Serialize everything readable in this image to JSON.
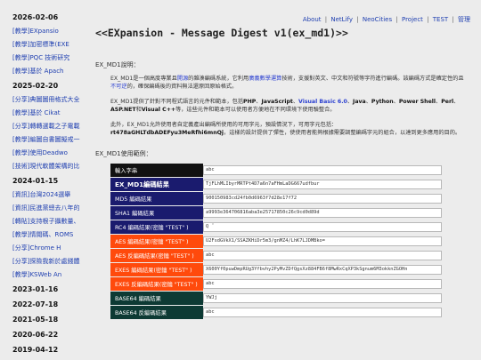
{
  "sidebar": {
    "entries": [
      {
        "type": "date",
        "text": "2026-02-06"
      },
      {
        "type": "link",
        "text": "[教學]EXpansio"
      },
      {
        "type": "link",
        "text": "[教學]加密標準(EXE"
      },
      {
        "type": "link",
        "text": "[教學]PQC 技術研究"
      },
      {
        "type": "link",
        "text": "[教學]基於 Apach"
      },
      {
        "type": "date",
        "text": "2025-02-20"
      },
      {
        "type": "link",
        "text": "[分享]典圖圖冊格式大全"
      },
      {
        "type": "link",
        "text": "[教學]基於 Cikat"
      },
      {
        "type": "link",
        "text": "[分享]轉轉選載之子電載"
      },
      {
        "type": "link",
        "text": "[教學]編圖自書圖擬戒一"
      },
      {
        "type": "link",
        "text": "[教學]使用Deadwo"
      },
      {
        "type": "link",
        "text": "[技術]現代軟體架構的比"
      },
      {
        "type": "date",
        "text": "2024-01-15"
      },
      {
        "type": "link",
        "text": "[資訊]台灣2024選舉"
      },
      {
        "type": "link",
        "text": "[資訊]民進黨總去八年的"
      },
      {
        "type": "link",
        "text": "[轉貼]支持根子攝數量、"
      },
      {
        "type": "link",
        "text": "[教學]情閱碼、ROMS"
      },
      {
        "type": "link",
        "text": "[分享]Chrome H"
      },
      {
        "type": "link",
        "text": "[分享]探險我新於處錢體"
      },
      {
        "type": "link",
        "text": "[教學]KSWeb An"
      },
      {
        "type": "date",
        "text": "2023-01-16"
      },
      {
        "type": "date",
        "text": "2022-07-18"
      },
      {
        "type": "date",
        "text": "2021-05-18"
      },
      {
        "type": "date",
        "text": "2020-06-22"
      },
      {
        "type": "date",
        "text": "2019-04-12"
      },
      {
        "type": "date",
        "text": "2018-07-18"
      }
    ]
  },
  "nav": {
    "about": "About",
    "netlify": "NetLify",
    "neocities": "NeoCities",
    "project": "Project",
    "test": "TEST",
    "admin": "管理",
    "sep": "|"
  },
  "page": {
    "title": "<<EXpansion - Message Digest v1(ex_md1)>>",
    "intro_label": "EX_MD1說明：",
    "p1_a": "EX_MD1是一個高度專業且",
    "p1_link1": "開源",
    "p1_b": "的雜湊編碼系統，它利用",
    "p1_link2": "廣義數學運算",
    "p1_c": "技術，支援對英文、中文和符號等字符進行編碼。該編碼方式是確定性的且",
    "p1_link3": "不可逆",
    "p1_d": "的，確保編碼後的資料無法還原回原始格式。",
    "p2_a": "EX_MD1提供了針對不同程式語言的元件和範本，包括",
    "p2_php": "PHP",
    "p2_js": "JavaScript",
    "p2_vb": "Visual Basic 6.0",
    "p2_java": "Java",
    "p2_py": "Python",
    "p2_ps": "Power Shell",
    "p2_perl": "Perl",
    "p2_asp": "ASP.NET",
    "p2_cpp": "Visual C++",
    "p2_and": "和",
    "p2_dot": "、",
    "p2_b": "等，這些元件和範本可以使用者方便地在不同環境下使用驗整合。",
    "p3_a": "此外，EX_MD1允許使用者自定義產出編碼所使用的可用字元，預設情況下，可用字元包括：",
    "p3_hash": "rt478aGHLTdbADEFyu3MeRfhi6mnQj",
    "p3_b": "，這樣的設計提供了彈性，使使用者能夠根據需要調整編碼字元的組合，以達到更多應用的目的。",
    "usage_label": "EX_MD1使用範例："
  },
  "usage": {
    "rows": [
      {
        "label": "輸入字串",
        "value": "abc",
        "color": "black",
        "bold": false
      },
      {
        "label": "EX_MD1編碼結果",
        "value": "TjFLhMLIbyrMRTPt4D7a6n7aFHmLaDG667udfbur",
        "color": "navy",
        "bold": true
      },
      {
        "label": "MD5 編碼結果",
        "value": "900150983cd24fb0d6963f7d28e17f72",
        "color": "navy",
        "bold": false
      },
      {
        "label": "SHA1 編碼結果",
        "value": "a9993e364706816aba3e25717850c26c9cd0d89d",
        "color": "navy",
        "bold": false
      },
      {
        "label": "RC4 編碼結果(密鑰 \"TEST\" )",
        "value": "Q ˇ",
        "color": "navy",
        "bold": false
      },
      {
        "label": "AES 編碼結果(密鑰 \"TEST\" )",
        "value": "U2FsdGVkX1/SSAZKHiDr5m3/gnMZ4/LhK7LJDMBko=",
        "color": "orange",
        "bold": false
      },
      {
        "label": "AES 反編碼結果(密鑰 \"TEST\" )",
        "value": "abc",
        "color": "orange",
        "bold": false
      },
      {
        "label": "EXES 編碼結果(密鑰 \"TEST\" )",
        "value": "X600Yf0puwDmpRUg3Yfbvhy2PyMvZDfQgsXz884FB6f8MwRxCqXP3kSgnum6M3okknZGOHn",
        "color": "orange",
        "bold": false
      },
      {
        "label": "EXES 反編碼結果(密鑰 \"TEST\" )",
        "value": "abc",
        "color": "orange",
        "bold": false
      },
      {
        "label": "BASE64 編碼結果",
        "value": "YWJj",
        "color": "green",
        "bold": false
      },
      {
        "label": "BASE64 反編碼結果",
        "value": "abc",
        "color": "green",
        "bold": false
      }
    ]
  },
  "colors": {
    "black": "#111111",
    "navy": "#1a1b6e",
    "orange": "#ff4a0c",
    "green": "#0d3a34",
    "link": "#1f3fb0"
  }
}
